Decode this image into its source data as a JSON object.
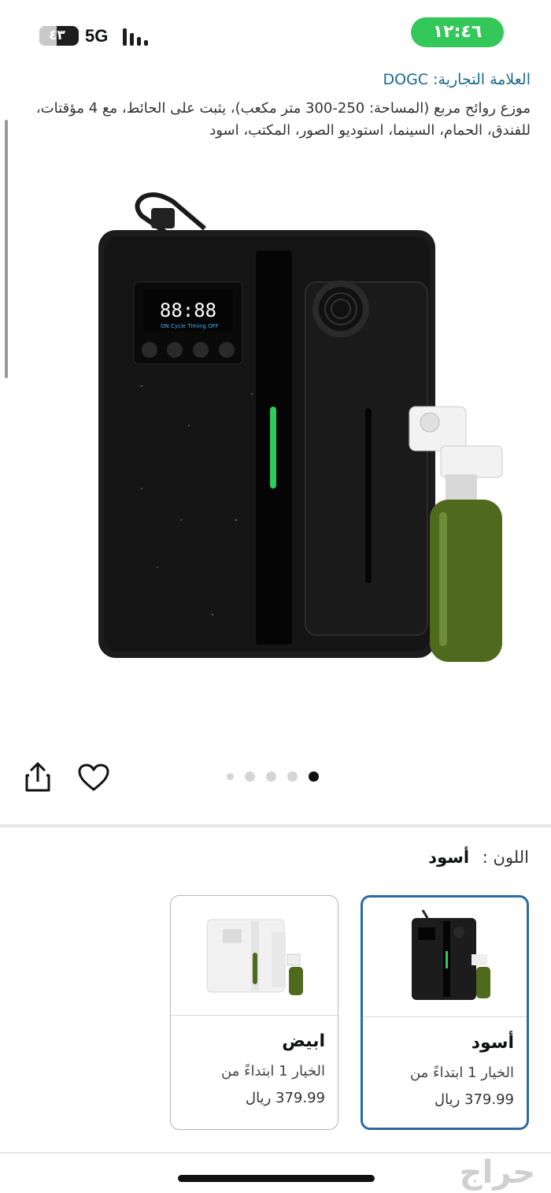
{
  "status_bar": {
    "battery_level": "٤٣",
    "network": "5G",
    "time": "١٢:٤٦"
  },
  "product": {
    "brand_line": "العلامة التجارية: DOGC",
    "title": "موزع روائح مربع (المساحة: 250-300 متر مكعب)، يثبت على الحائط، مع 4 مؤقتات، للفندق، الحمام، السينما، استوديو الصور، المكتب، اسود",
    "device_display": "88:88",
    "image_count": 5,
    "active_image_index": 4
  },
  "color_selector": {
    "label": "اللون :",
    "selected": "أسود"
  },
  "variants": [
    {
      "name": "أسود",
      "option": "الخيار 1 ابتداءً من",
      "price": "379.99 ريال",
      "selected": true
    },
    {
      "name": "ابيض",
      "option": "الخيار 1 ابتداءً من",
      "price": "379.99 ريال",
      "selected": false
    }
  ],
  "watermark": "حراج",
  "colors": {
    "status_pill": "#34c759",
    "brand_link": "#1a6a8c",
    "selected_border": "#2c6aa0"
  }
}
